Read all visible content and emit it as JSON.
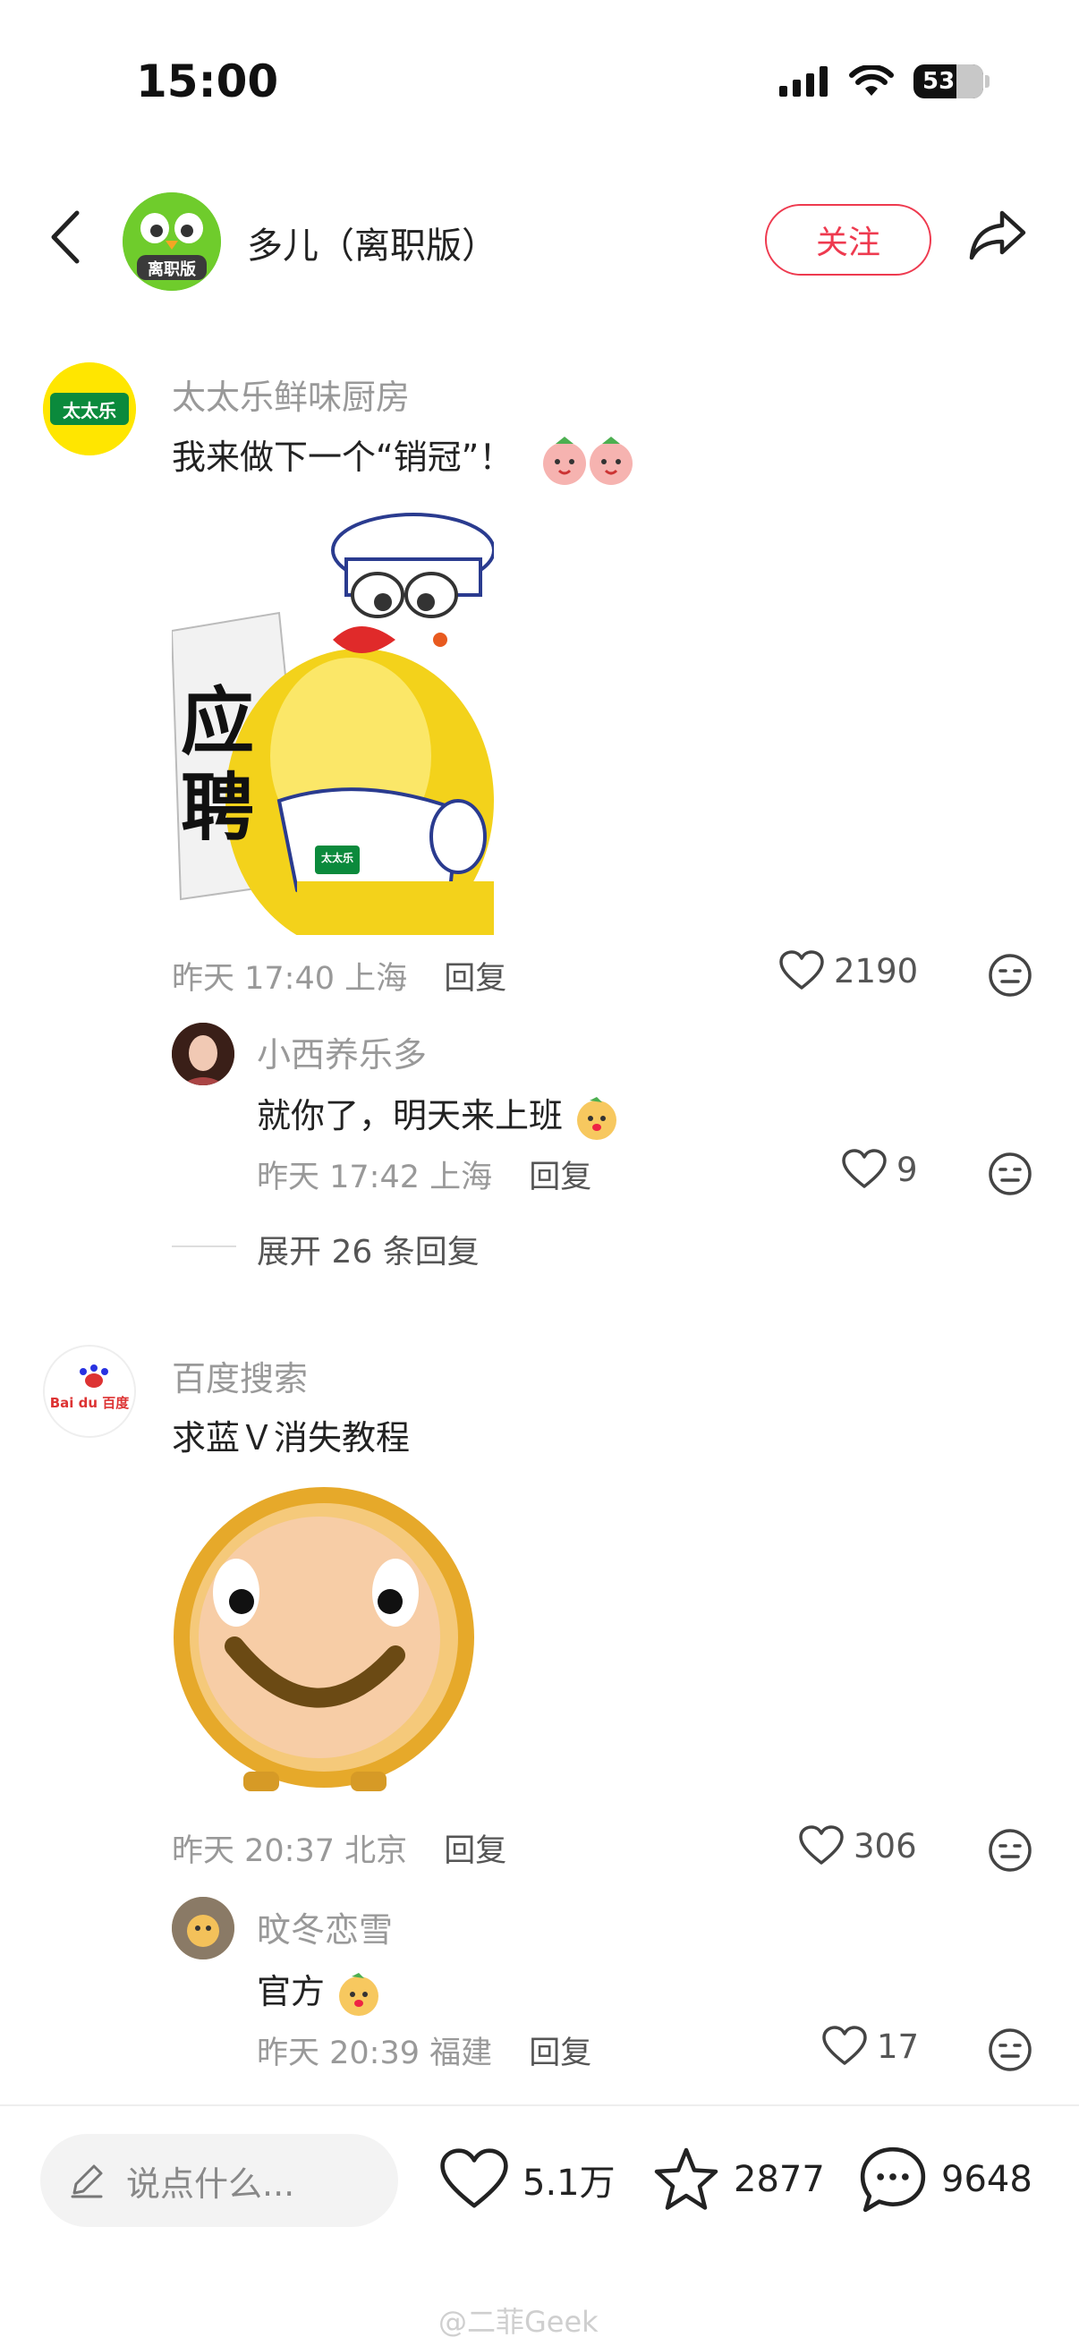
{
  "status": {
    "time": "15:00",
    "battery": "53"
  },
  "header": {
    "title": "多儿（离职版）",
    "avatar_badge": "离职版",
    "follow_label": "关注"
  },
  "comments": [
    {
      "user": "太太乐鲜味厨房",
      "avatar_text": "太太乐",
      "text": "我来做下一个“销冠”！",
      "sticker_text": [
        "应",
        "聘"
      ],
      "apron_text": "太太乐",
      "time": "昨天 17:40",
      "location": "上海",
      "reply_label": "回复",
      "likes": "2190",
      "reply": {
        "user": "小西养乐多",
        "text": "就你了，明天来上班",
        "time": "昨天 17:42",
        "location": "上海",
        "reply_label": "回复",
        "likes": "9"
      },
      "expand_label": "展开 26 条回复"
    },
    {
      "user": "百度搜索",
      "avatar_text": "Bai du 百度",
      "text": "求蓝Ｖ消失教程",
      "time": "昨天 20:37",
      "location": "北京",
      "reply_label": "回复",
      "likes": "306",
      "reply": {
        "user": "旼冬恋雪",
        "text": "官方",
        "time": "昨天 20:39",
        "location": "福建",
        "reply_label": "回复",
        "likes": "17"
      }
    }
  ],
  "bottom": {
    "placeholder": "说点什么...",
    "likes": "5.1万",
    "stars": "2877",
    "comments": "9648"
  },
  "watermark": "@二菲Geek",
  "colors": {
    "accent": "#ee3a4f",
    "muted": "#999999"
  }
}
